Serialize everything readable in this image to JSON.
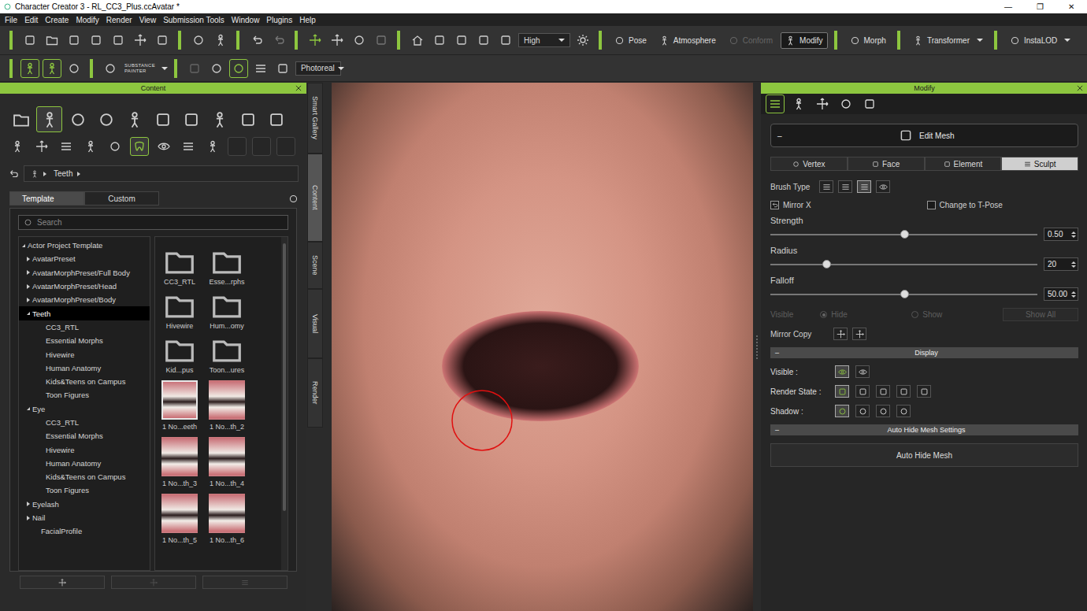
{
  "window": {
    "title": "Character Creator 3 - RL_CC3_Plus.ccAvatar *",
    "controls": [
      "—",
      "❐",
      "✕"
    ]
  },
  "menu": [
    "File",
    "Edit",
    "Create",
    "Modify",
    "Render",
    "View",
    "Submission Tools",
    "Window",
    "Plugins",
    "Help"
  ],
  "toolbar": {
    "quality": "High",
    "buttons": [
      {
        "label": "Pose",
        "disabled": false,
        "selected": false,
        "dropdown": false
      },
      {
        "label": "Atmosphere",
        "disabled": false,
        "selected": false,
        "dropdown": false
      },
      {
        "label": "Conform",
        "disabled": true,
        "selected": false,
        "dropdown": false
      },
      {
        "label": "Modify",
        "disabled": false,
        "selected": true,
        "dropdown": false
      },
      {
        "label": "Morph",
        "disabled": false,
        "selected": false,
        "dropdown": false
      },
      {
        "label": "Transformer",
        "disabled": false,
        "selected": false,
        "dropdown": true
      },
      {
        "label": "InstaLOD",
        "disabled": false,
        "selected": false,
        "dropdown": true
      }
    ]
  },
  "toolbar2": {
    "tools": [
      {
        "selected": true
      },
      {
        "selected": true
      },
      {
        "selected": false
      }
    ],
    "substance": [
      "SUBSTANCE",
      "PAINTER"
    ],
    "render_mode": "Photoreal"
  },
  "content": {
    "title": "Content",
    "categories": [
      {
        "selected": false
      },
      {
        "selected": true
      },
      {
        "selected": false
      },
      {
        "selected": false
      },
      {
        "selected": false
      },
      {
        "selected": false
      },
      {
        "selected": false
      },
      {
        "selected": false
      },
      {
        "selected": false
      },
      {
        "selected": false
      }
    ],
    "subcategories": [
      {
        "kind": "icon",
        "selected": false
      },
      {
        "kind": "icon",
        "selected": false
      },
      {
        "kind": "icon",
        "selected": false
      },
      {
        "kind": "icon",
        "selected": false
      },
      {
        "kind": "icon",
        "selected": false
      },
      {
        "kind": "icon",
        "selected": true
      },
      {
        "kind": "icon",
        "selected": false
      },
      {
        "kind": "icon",
        "selected": false
      },
      {
        "kind": "icon",
        "selected": false
      },
      {
        "kind": "empty",
        "selected": false
      },
      {
        "kind": "empty",
        "selected": false
      },
      {
        "kind": "empty",
        "selected": false
      }
    ],
    "breadcrumb": "Teeth",
    "tabs": [
      {
        "label": "Template",
        "selected": true
      },
      {
        "label": "Custom",
        "selected": false
      }
    ],
    "search": {
      "placeholder": "Search"
    },
    "tree": [
      {
        "label": "Actor Project Template",
        "depth": 0,
        "kind": "branch",
        "expanded": true,
        "selected": false
      },
      {
        "label": "AvatarPreset",
        "depth": 1,
        "kind": "branch",
        "expanded": false,
        "selected": false
      },
      {
        "label": "AvatarMorphPreset/Full Body",
        "depth": 1,
        "kind": "branch",
        "expanded": false,
        "selected": false
      },
      {
        "label": "AvatarMorphPreset/Head",
        "depth": 1,
        "kind": "branch",
        "expanded": false,
        "selected": false
      },
      {
        "label": "AvatarMorphPreset/Body",
        "depth": 1,
        "kind": "branch",
        "expanded": false,
        "selected": false
      },
      {
        "label": "Teeth",
        "depth": 1,
        "kind": "branch",
        "expanded": true,
        "selected": true
      },
      {
        "label": "CC3_RTL",
        "depth": 2,
        "kind": "leaf",
        "expanded": false,
        "selected": false
      },
      {
        "label": "Essential Morphs",
        "depth": 2,
        "kind": "leaf",
        "expanded": false,
        "selected": false
      },
      {
        "label": "Hivewire",
        "depth": 2,
        "kind": "leaf",
        "expanded": false,
        "selected": false
      },
      {
        "label": "Human Anatomy",
        "depth": 2,
        "kind": "leaf",
        "expanded": false,
        "selected": false
      },
      {
        "label": "Kids&Teens on Campus",
        "depth": 2,
        "kind": "leaf",
        "expanded": false,
        "selected": false
      },
      {
        "label": "Toon Figures",
        "depth": 2,
        "kind": "leaf",
        "expanded": false,
        "selected": false
      },
      {
        "label": "Eye",
        "depth": 1,
        "kind": "branch",
        "expanded": true,
        "selected": false
      },
      {
        "label": "CC3_RTL",
        "depth": 2,
        "kind": "leaf",
        "expanded": false,
        "selected": false
      },
      {
        "label": "Essential Morphs",
        "depth": 2,
        "kind": "leaf",
        "expanded": false,
        "selected": false
      },
      {
        "label": "Hivewire",
        "depth": 2,
        "kind": "leaf",
        "expanded": false,
        "selected": false
      },
      {
        "label": "Human Anatomy",
        "depth": 2,
        "kind": "leaf",
        "expanded": false,
        "selected": false
      },
      {
        "label": "Kids&Teens on Campus",
        "depth": 2,
        "kind": "leaf",
        "expanded": false,
        "selected": false
      },
      {
        "label": "Toon Figures",
        "depth": 2,
        "kind": "leaf",
        "expanded": false,
        "selected": false
      },
      {
        "label": "Eyelash",
        "depth": 1,
        "kind": "branch",
        "expanded": false,
        "selected": false
      },
      {
        "label": "Nail",
        "depth": 1,
        "kind": "branch",
        "expanded": false,
        "selected": false
      },
      {
        "label": "FacialProfile",
        "depth": 1,
        "kind": "leaf",
        "expanded": false,
        "selected": false
      }
    ],
    "items": [
      {
        "label": "CC3_RTL",
        "kind": "folder",
        "selected": false
      },
      {
        "label": "Esse...rphs",
        "kind": "folder",
        "selected": false
      },
      {
        "label": "Hivewire",
        "kind": "folder",
        "selected": false
      },
      {
        "label": "Hum...omy",
        "kind": "folder",
        "selected": false
      },
      {
        "label": "Kid...pus",
        "kind": "folder",
        "selected": false
      },
      {
        "label": "Toon...ures",
        "kind": "folder",
        "selected": false
      },
      {
        "label": "1 No...eeth",
        "kind": "thumb",
        "selected": true
      },
      {
        "label": "1 No...th_2",
        "kind": "thumb",
        "selected": false
      },
      {
        "label": "1 No...th_3",
        "kind": "thumb",
        "selected": false
      },
      {
        "label": "1 No...th_4",
        "kind": "thumb",
        "selected": false
      },
      {
        "label": "1 No...th_5",
        "kind": "thumb",
        "selected": false
      },
      {
        "label": "1 No...th_6",
        "kind": "thumb",
        "selected": false
      }
    ]
  },
  "side_tabs": [
    {
      "label": "Smart Gallery",
      "selected": false
    },
    {
      "label": "Content",
      "selected": true
    },
    {
      "label": "Scene",
      "selected": false
    },
    {
      "label": "Visual",
      "selected": false
    },
    {
      "label": "Render",
      "selected": false
    }
  ],
  "modify": {
    "title": "Modify",
    "tab_icons": [
      {
        "selected": true
      },
      {
        "selected": false
      },
      {
        "selected": false
      },
      {
        "selected": false
      },
      {
        "selected": false
      }
    ],
    "edit_mesh": {
      "toggle": "–",
      "label": "Edit Mesh"
    },
    "modes": [
      {
        "label": "Vertex",
        "selected": false
      },
      {
        "label": "Face",
        "selected": false
      },
      {
        "label": "Element",
        "selected": false
      },
      {
        "label": "Sculpt",
        "selected": true
      }
    ],
    "brush_type": {
      "label": "Brush Type",
      "icons": [
        {
          "selected": false
        },
        {
          "selected": false
        },
        {
          "selected": true
        },
        {
          "selected": false
        }
      ]
    },
    "checks": [
      {
        "label": "Mirror X",
        "checked": true
      },
      {
        "label": "Change to T-Pose",
        "checked": false
      }
    ],
    "sliders": [
      {
        "label": "Strength",
        "level": 0.5,
        "value": "0.50"
      },
      {
        "label": "Radius",
        "level": 0.21,
        "value": "20"
      },
      {
        "label": "Falloff",
        "level": 0.5,
        "value": "50.00"
      }
    ],
    "visible": {
      "label": "Visible",
      "disabled": true,
      "options": [
        {
          "label": "Hide",
          "selected": true
        },
        {
          "label": "Show",
          "selected": false
        }
      ],
      "button": "Show All"
    },
    "mirror_copy": "Mirror Copy",
    "display": {
      "toggle": "–",
      "title": "Display",
      "rows": [
        {
          "label": "Visible :",
          "icons": [
            {
              "selected": true
            },
            {
              "selected": false
            }
          ]
        },
        {
          "label": "Render State :",
          "icons": [
            {
              "selected": true
            },
            {
              "selected": false
            },
            {
              "selected": false
            },
            {
              "selected": false
            },
            {
              "selected": false
            }
          ]
        },
        {
          "label": "Shadow :",
          "icons": [
            {
              "selected": true
            },
            {
              "selected": false
            },
            {
              "selected": false
            },
            {
              "selected": false
            }
          ]
        }
      ]
    },
    "auto_hide": {
      "toggle": "–",
      "title": "Auto Hide Mesh Settings",
      "button": "Auto Hide Mesh"
    }
  }
}
